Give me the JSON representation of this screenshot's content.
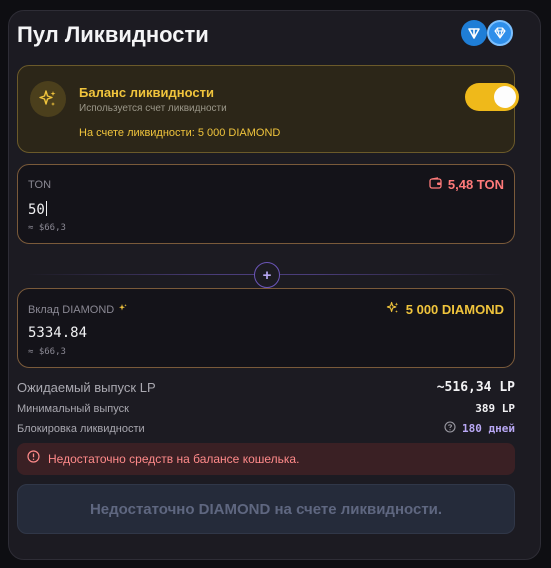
{
  "header": {
    "title": "Пул Ликвидности"
  },
  "liquidity": {
    "title": "Баланс ликвидности",
    "subtitle": "Используется счет ликвидности",
    "balance_text": "На счете ликвидности: 5 000 DIAMOND",
    "toggle_on": true
  },
  "ton_input": {
    "label": "TON",
    "wallet_balance": "5,48 TON",
    "value": "50",
    "usd": "≈ $66,3"
  },
  "diamond_input": {
    "label": "Вклад DIAMOND",
    "balance": "5 000 DIAMOND",
    "value": "5334.84",
    "usd": "≈ $66,3"
  },
  "stats": {
    "expected_lp_label": "Ожидаемый выпуск LP",
    "expected_lp_value": "~516,34 LP",
    "min_output_label": "Минимальный выпуск",
    "min_output_value": "389 LP",
    "lock_label": "Блокировка ликвидности",
    "lock_value": "180 дней"
  },
  "error": {
    "text": "Недостаточно средств на балансе кошелька."
  },
  "submit": {
    "label": "Недостаточно DIAMOND на счете ликвидности."
  },
  "colors": {
    "accent_gold": "#f0c43c",
    "error_red": "#ff7a7a",
    "purple": "#b9a8f5",
    "ton_blue": "#1f7ed6"
  },
  "icons": {
    "ton": "ton-coin-icon",
    "diamond": "diamond-coin-icon",
    "sparkles": "sparkles-icon",
    "wallet": "wallet-icon",
    "plus": "plus-icon",
    "question": "question-circle-icon",
    "alert": "alert-circle-icon"
  }
}
